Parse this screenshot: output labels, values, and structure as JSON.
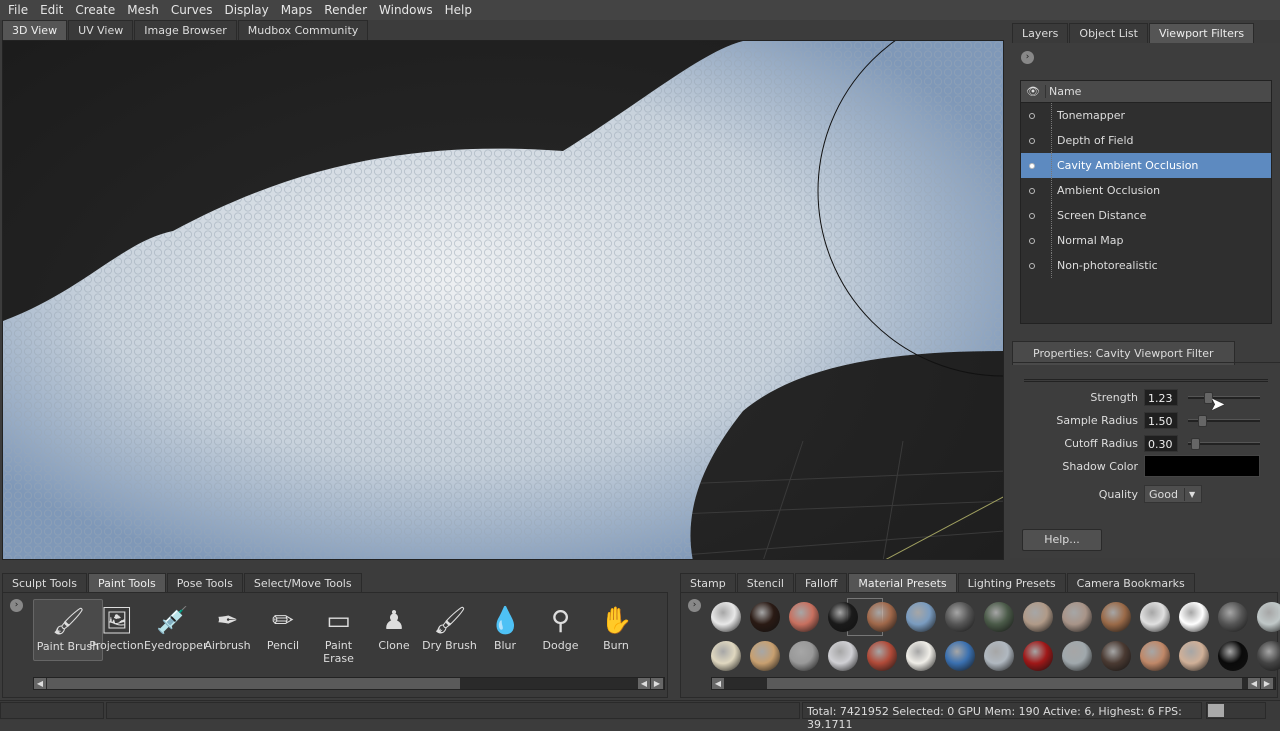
{
  "menu": [
    "File",
    "Edit",
    "Create",
    "Mesh",
    "Curves",
    "Display",
    "Maps",
    "Render",
    "Windows",
    "Help"
  ],
  "viewport_tabs": [
    "3D View",
    "UV View",
    "Image Browser",
    "Mudbox Community"
  ],
  "right_tabs": [
    "Layers",
    "Object List",
    "Viewport Filters"
  ],
  "filters": {
    "header": "Name",
    "items": [
      "Tonemapper",
      "Depth of Field",
      "Cavity Ambient Occlusion",
      "Ambient Occlusion",
      "Screen Distance",
      "Normal Map",
      "Non-photorealistic"
    ],
    "selected": 2
  },
  "properties": {
    "title": "Properties: Cavity Viewport Filter",
    "strength_label": "Strength",
    "strength": "1.23",
    "sample_label": "Sample Radius",
    "sample": "1.50",
    "cutoff_label": "Cutoff Radius",
    "cutoff": "0.30",
    "shadow_label": "Shadow Color",
    "shadow_color": "#000000",
    "quality_label": "Quality",
    "quality": "Good",
    "help": "Help..."
  },
  "tool_tabs": [
    "Sculpt Tools",
    "Paint Tools",
    "Pose Tools",
    "Select/Move Tools"
  ],
  "tools": [
    {
      "label": "Paint Brush",
      "icon": "paint-brush-icon",
      "glyph": "🖌"
    },
    {
      "label": "Projection",
      "icon": "projection-icon",
      "glyph": "🖼"
    },
    {
      "label": "Eyedropper",
      "icon": "eyedropper-icon",
      "glyph": "💉"
    },
    {
      "label": "Airbrush",
      "icon": "airbrush-icon",
      "glyph": "✒"
    },
    {
      "label": "Pencil",
      "icon": "pencil-icon",
      "glyph": "✏"
    },
    {
      "label": "Paint Erase",
      "icon": "eraser-icon",
      "glyph": "▭"
    },
    {
      "label": "Clone",
      "icon": "clone-stamp-icon",
      "glyph": "♟"
    },
    {
      "label": "Dry Brush",
      "icon": "dry-brush-icon",
      "glyph": "🖌"
    },
    {
      "label": "Blur",
      "icon": "blur-drop-icon",
      "glyph": "💧"
    },
    {
      "label": "Dodge",
      "icon": "dodge-icon",
      "glyph": "⚲"
    },
    {
      "label": "Burn",
      "icon": "burn-hand-icon",
      "glyph": "✋"
    }
  ],
  "preset_tabs": [
    "Stamp",
    "Stencil",
    "Falloff",
    "Material Presets",
    "Lighting Presets",
    "Camera Bookmarks"
  ],
  "materials": [
    [
      "#e8e8e8",
      "#2a1a14",
      "#c8705f",
      "#1a1a1a",
      "#a0684a",
      "#7a9cc0",
      "#555",
      "#4a5a48",
      "#b09a88",
      "#a89488",
      "#9a6a48",
      "#e0e0e0",
      "#ffffff",
      "#555555",
      "#c0c8c8"
    ],
    [
      "#e0d8c0",
      "#c8a070",
      "#999",
      "#d0d0d4",
      "#b04a38",
      "#f0eee8",
      "#3a70b0",
      "#b0b8c0",
      "#a01818",
      "#a0a8ac",
      "#4a3a32",
      "#c08868",
      "#d0b098",
      "#0a0a0a",
      "#444"
    ]
  ],
  "status": "Total: 7421952  Selected: 0 GPU Mem: 190  Active: 6, Highest: 6  FPS: 39.1711"
}
